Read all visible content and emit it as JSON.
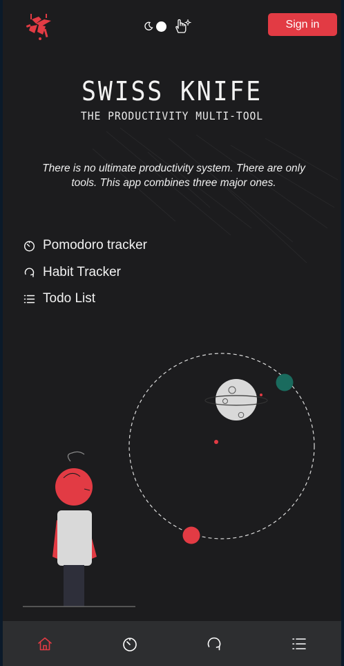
{
  "header": {
    "sign_in_label": "Sign in",
    "theme": "dark"
  },
  "hero": {
    "title": "SWISS KNIFE",
    "subtitle": "THE PRODUCTIVITY MULTI-TOOL",
    "tagline": "There is no ultimate productivity system. There are only tools. This app combines three major ones."
  },
  "features": [
    {
      "label": "Pomodoro tracker",
      "icon": "timer-icon"
    },
    {
      "label": "Habit Tracker",
      "icon": "refresh-icon"
    },
    {
      "label": "Todo List",
      "icon": "list-icon"
    }
  ],
  "bottom_nav": [
    {
      "name": "home",
      "icon": "home-icon",
      "active": true
    },
    {
      "name": "pomodoro",
      "icon": "timer-icon",
      "active": false
    },
    {
      "name": "habits",
      "icon": "refresh-icon",
      "active": false
    },
    {
      "name": "todo",
      "icon": "list-icon",
      "active": false
    }
  ],
  "colors": {
    "accent": "#e23b44",
    "background": "#1c1c1e",
    "nav_background": "#2d2e30",
    "planet_teal": "#1a6b5e"
  }
}
